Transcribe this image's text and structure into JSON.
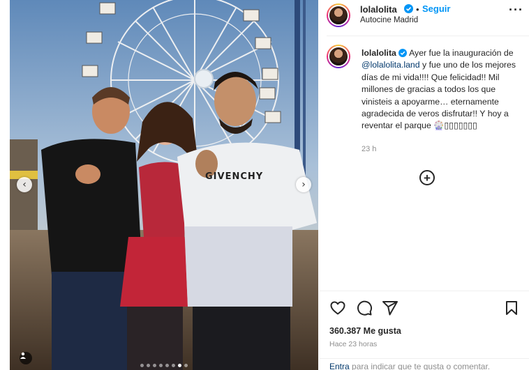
{
  "post": {
    "photo_alt": "",
    "slide_dots": 8,
    "active_dot": 7
  },
  "header": {
    "username": "lolalolita",
    "separator": "•",
    "follow_label": "Seguir",
    "location": "Autocine Madrid",
    "more_icon": "more-horizontal-icon"
  },
  "caption": {
    "username": "lolalolita",
    "text_before": "Ayer fue la inauguración de ",
    "mention": "@lolalolita.land",
    "text_after": " y fue uno de los mejores días de mi vida!!!! Que felicidad!! Mil millones de gracias a todos los que vinisteis a apoyarme… eternamente agradecida de veros disfrutar!! Y hoy a reventar el parque ",
    "emojis": "🎡▯▯▯▯▯▯▯",
    "time": "23 h"
  },
  "actions": {
    "likes": "360.387 Me gusta",
    "ago": "Hace 23 horas",
    "comment_link": "Entra",
    "comment_prompt": " para indicar que te gusta o comentar."
  },
  "colors": {
    "accent": "#0095f6",
    "verified": "#0095f6",
    "mention": "#00376b",
    "muted": "#8e8e8e"
  }
}
